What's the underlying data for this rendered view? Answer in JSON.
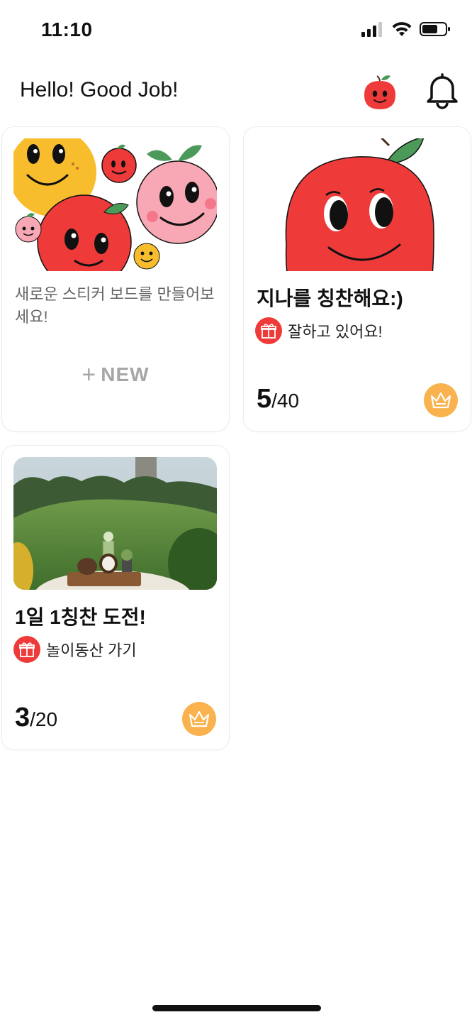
{
  "status_bar": {
    "time": "11:10"
  },
  "header": {
    "title": "Hello! Good Job!"
  },
  "boards": [
    {
      "type": "new",
      "description": "새로운 스티커 보드를 만들어보세요!",
      "new_plus": "+",
      "new_label": "NEW"
    },
    {
      "type": "board",
      "title": "지나를 칭찬해요:)",
      "reward": "잘하고 있어요!",
      "current": "5",
      "total": "/40"
    },
    {
      "type": "board",
      "title": "1일 1칭찬 도전!",
      "reward": "놀이동산 가기",
      "current": "3",
      "total": "/20"
    }
  ],
  "colors": {
    "apple_red": "#ef3a3a",
    "leaf_green": "#4c9a5a",
    "crown_orange": "#f9b24d",
    "smiley_yellow": "#f7bd2d",
    "peach_pink": "#f7a8b4"
  },
  "icons": {
    "avatar": "apple-avatar-icon",
    "notification": "bell-icon",
    "reward": "gift-icon",
    "badge": "crown-icon"
  }
}
